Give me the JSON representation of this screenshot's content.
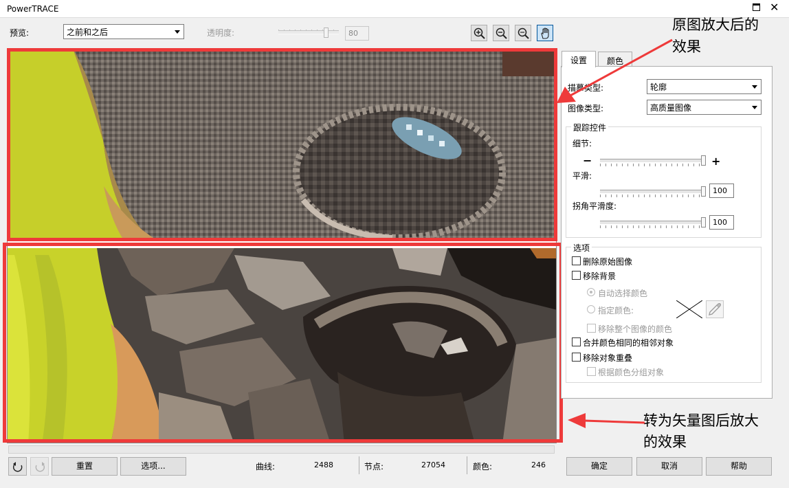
{
  "window": {
    "title": "PowerTRACE"
  },
  "toolbar": {
    "preview_label": "预览:",
    "preview_value": "之前和之后",
    "transparency_label": "透明度:",
    "transparency_value": "80",
    "transparency_level": 0.8,
    "tools": [
      "zoom-in-icon",
      "zoom-out-icon",
      "zoom-fit-icon",
      "pan-hand-icon"
    ]
  },
  "tabs": {
    "settings": "设置",
    "colors": "颜色"
  },
  "settings": {
    "trace_type_label": "描摹类型:",
    "trace_type_value": "轮廓",
    "image_type_label": "图像类型:",
    "image_type_value": "高质量图像",
    "trace_controls": {
      "title": "跟踪控件",
      "detail_label": "细节:",
      "detail_level": 1.0,
      "smoothing_label": "平滑:",
      "smoothing_value": "100",
      "corner_label": "拐角平滑度:",
      "corner_value": "100"
    },
    "options": {
      "title": "选项",
      "delete_original": "删除原始图像",
      "remove_background": "移除背景",
      "auto_select_color": "自动选择颜色",
      "specify_color": "指定颜色:",
      "remove_color_whole": "移除整个图像的颜色",
      "merge_adjacent": "合并颜色相同的相邻对象",
      "remove_overlap": "移除对象重叠",
      "group_by_color": "根据颜色分组对象"
    }
  },
  "bottom": {
    "reset_label": "重置",
    "options_label": "选项...",
    "curves_label": "曲线:",
    "curves_value": "2488",
    "nodes_label": "节点:",
    "nodes_value": "27054",
    "colors_label": "颜色:",
    "colors_value": "246",
    "ok_label": "确定",
    "cancel_label": "取消",
    "help_label": "帮助"
  },
  "annotations": {
    "top_line1": "原图放大后的",
    "top_line2": "效果",
    "bottom_line1": "转为矢量图后放大",
    "bottom_line2": "的效果",
    "color": "#ee3a3a"
  }
}
